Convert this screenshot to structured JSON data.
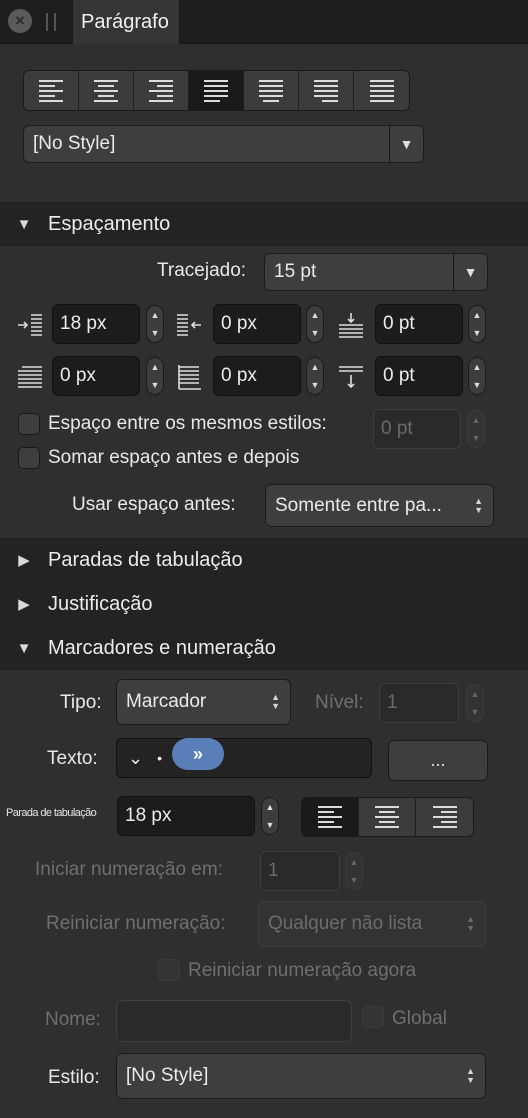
{
  "panel": {
    "tab_title": "Parágrafo"
  },
  "top": {
    "paragraph_style": "[No Style]"
  },
  "alignment": {
    "buttons": [
      "align-left",
      "align-center",
      "align-right",
      "justify-left",
      "justify-center",
      "justify-right",
      "justify-all"
    ],
    "active_index": 3
  },
  "spacing": {
    "header": "Espaçamento",
    "leading_label": "Tracejado:",
    "leading_value": "15 pt",
    "left_indent": "18 px",
    "first_line_indent": "0 px",
    "space_before": "0 pt",
    "right_indent": "0 px",
    "last_line_indent": "0 px",
    "space_after": "0 pt",
    "same_styles_label": "Espaço entre os mesmos estilos:",
    "same_styles_value": "0 pt",
    "sum_space_label": "Somar espaço antes e depois",
    "use_space_before_label": "Usar espaço antes:",
    "use_space_before_value": "Somente entre pa..."
  },
  "sections": {
    "tab_stops": "Paradas de tabulação",
    "justification": "Justificação",
    "bullets": "Marcadores e numeração"
  },
  "bullets": {
    "type_label": "Tipo:",
    "type_value": "Marcador",
    "level_label": "Nível:",
    "level_value": "1",
    "text_label": "Texto:",
    "text_chevron": "⌄",
    "text_bullet": "•",
    "text_pill": "»",
    "more_button": "...",
    "tab_stop_label": "Parada de tabulação",
    "tab_stop_value": "18 px",
    "start_numbering_label": "Iniciar numeração em:",
    "start_numbering_value": "1",
    "restart_label": "Reiniciar numeração:",
    "restart_value": "Qualquer não lista",
    "restart_now_label": "Reiniciar numeração agora",
    "name_label": "Nome:",
    "name_value": "",
    "global_label": "Global",
    "style_label": "Estilo:",
    "style_value": "[No Style]"
  }
}
